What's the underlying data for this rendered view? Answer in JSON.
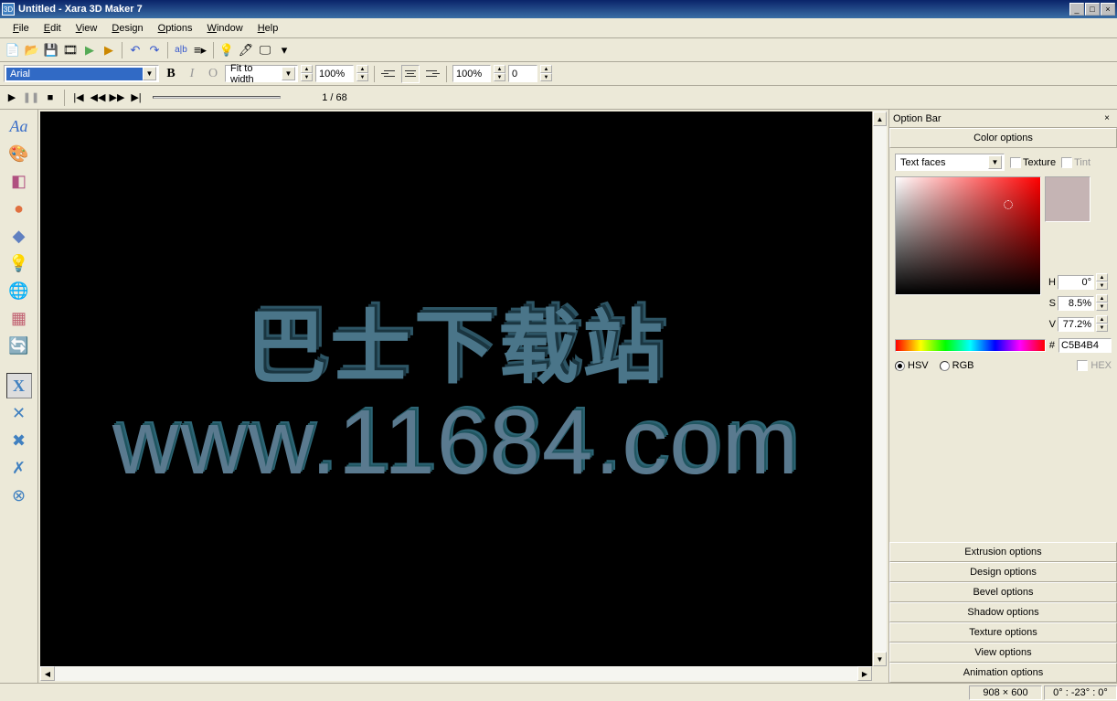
{
  "title": "Untitled - Xara 3D Maker 7",
  "menu": [
    "File",
    "Edit",
    "View",
    "Design",
    "Options",
    "Window",
    "Help"
  ],
  "font_combo": "Arial",
  "fit_combo": "Fit to width",
  "zoom1": "100%",
  "zoom2": "100%",
  "num1": "0",
  "frame_counter": "1 / 68",
  "canvas_line1": "巴士下载站",
  "canvas_line2": "www.11684.com",
  "optionbar_title": "Option Bar",
  "sections": {
    "color": "Color options",
    "extrusion": "Extrusion options",
    "design": "Design options",
    "bevel": "Bevel options",
    "shadow": "Shadow options",
    "texture": "Texture options",
    "view": "View options",
    "animation": "Animation options"
  },
  "color_target": "Text faces",
  "texture_cb": "Texture",
  "tint_cb": "Tint",
  "hsv": {
    "h_lbl": "H",
    "h": "0°",
    "s_lbl": "S",
    "s": "8.5%",
    "v_lbl": "V",
    "v": "77.2%"
  },
  "hex_hash": "#",
  "hex": "C5B4B4",
  "mode_hsv": "HSV",
  "mode_rgb": "RGB",
  "mode_hex": "HEX",
  "status": {
    "dims": "908 × 600",
    "angles": "0° : -23° : 0°"
  }
}
